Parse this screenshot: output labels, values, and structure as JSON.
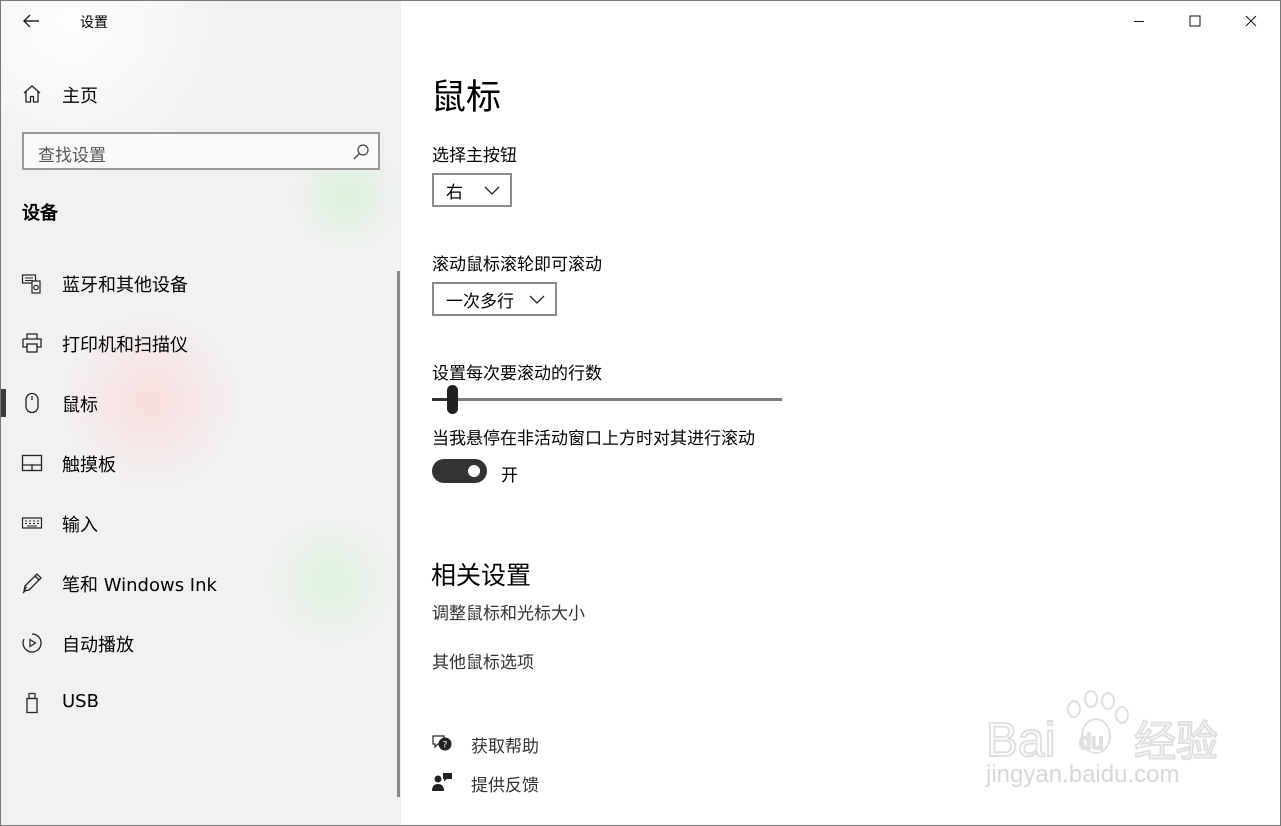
{
  "window": {
    "title": "设置",
    "controls": {
      "minimize": "minimize-icon",
      "maximize": "maximize-icon",
      "close": "close-icon"
    }
  },
  "sidebar": {
    "home_label": "主页",
    "search_placeholder": "查找设置",
    "section_title": "设备",
    "items": [
      {
        "label": "蓝牙和其他设备",
        "icon": "bluetooth-devices-icon"
      },
      {
        "label": "打印机和扫描仪",
        "icon": "printer-icon"
      },
      {
        "label": "鼠标",
        "icon": "mouse-icon",
        "selected": true
      },
      {
        "label": "触摸板",
        "icon": "touchpad-icon"
      },
      {
        "label": "输入",
        "icon": "keyboard-icon"
      },
      {
        "label": "笔和 Windows Ink",
        "icon": "pen-icon"
      },
      {
        "label": "自动播放",
        "icon": "autoplay-icon"
      },
      {
        "label": "USB",
        "icon": "usb-icon"
      }
    ]
  },
  "main": {
    "title": "鼠标",
    "primary_button": {
      "label": "选择主按钮",
      "value": "右"
    },
    "scroll_mode": {
      "label": "滚动鼠标滚轮即可滚动",
      "value": "一次多行"
    },
    "scroll_lines": {
      "label": "设置每次要滚动的行数",
      "fraction": 0.03
    },
    "inactive_scroll": {
      "label": "当我悬停在非活动窗口上方时对其进行滚动",
      "state": "开",
      "on": true
    },
    "related": {
      "title": "相关设置",
      "links": [
        "调整鼠标和光标大小",
        "其他鼠标选项"
      ]
    },
    "help": {
      "get_help": "获取帮助",
      "feedback": "提供反馈"
    }
  },
  "watermark": {
    "brand": "Bai du 经验",
    "url": "jingyan.baidu.com"
  }
}
